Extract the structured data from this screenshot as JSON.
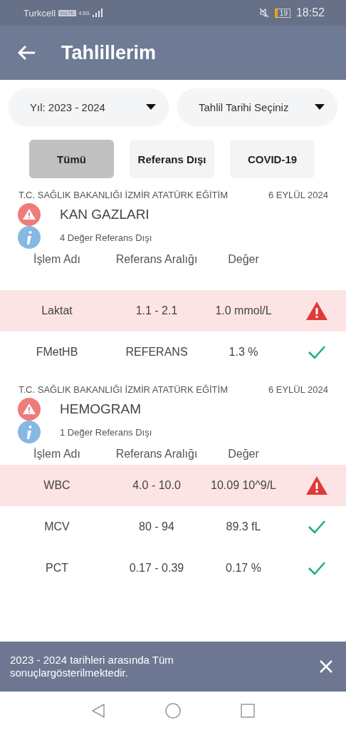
{
  "status_bar": {
    "carrier": "Turkcell",
    "volte": "VoLTE",
    "network": "4.5G",
    "battery": "19",
    "time": "18:52"
  },
  "header": {
    "title": "Tahlillerim"
  },
  "filters": [
    {
      "label": "Yıl: 2023 - 2024"
    },
    {
      "label": "Tahlil Tarihi Seçiniz"
    }
  ],
  "tabs": [
    {
      "label": "Tümü",
      "selected": true
    },
    {
      "label": "Referans Dışı",
      "selected": false
    },
    {
      "label": "COVID-19",
      "selected": false
    }
  ],
  "sections": [
    {
      "hospital": "T.C. SAĞLIK BAKANLIĞI İZMİR ATATÜRK EĞİTİM",
      "date": "6 EYLÜL 2024",
      "title": "KAN GAZLARI",
      "info": "4 Değer Referans Dışı",
      "columns": [
        "İşlem Adı",
        "Referans Aralığı",
        "Değer"
      ],
      "rows": [
        {
          "name": "Laktat",
          "range": "1.1 - 2.1",
          "value": "1.0 mmol/L",
          "kind": "alert"
        },
        {
          "name": "FMetHB",
          "range": "REFERANS",
          "value": "1.3 %",
          "kind": "ok"
        }
      ]
    },
    {
      "hospital": "T.C. SAĞLIK BAKANLIĞI İZMİR ATATÜRK EĞİTİM",
      "date": "6 EYLÜL 2024",
      "title": "HEMOGRAM",
      "info": "1 Değer Referans Dışı",
      "columns": [
        "İşlem Adı",
        "Referans Aralığı",
        "Değer"
      ],
      "rows": [
        {
          "name": "WBC",
          "range": "4.0 - 10.0",
          "value": "10.09 10^9/L",
          "kind": "alert"
        },
        {
          "name": "MCV",
          "range": "80 - 94",
          "value": "89.3 fL",
          "kind": "ok"
        },
        {
          "name": "PCT",
          "range": "0.17 - 0.39",
          "value": "0.17 %",
          "kind": "ok"
        }
      ]
    }
  ],
  "snackbar": {
    "text": "2023 - 2024 tarihleri arasında Tüm sonuçlargösterilmektedir."
  }
}
